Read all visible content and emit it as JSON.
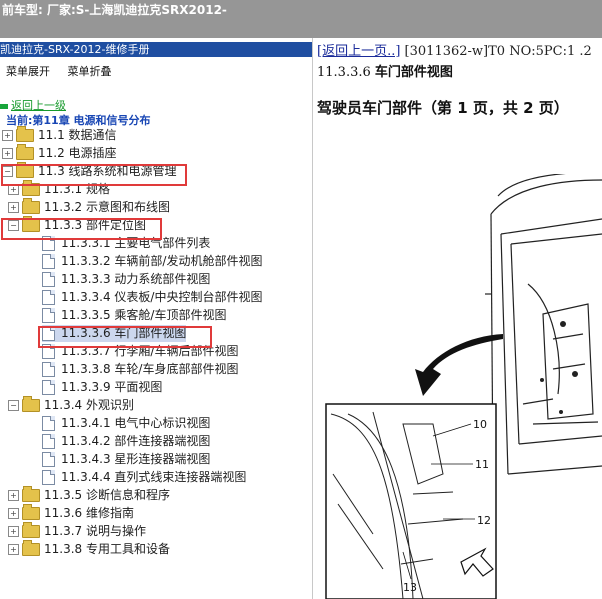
{
  "topbar": {
    "text": "前车型:   厂家:S-上海凯迪拉克SRX2012-"
  },
  "left_panel": {
    "title": "凯迪拉克-SRX-2012-维修手册",
    "expand_label": "菜单展开",
    "collapse_label": "菜单折叠",
    "back_up_label": "返回上一级",
    "current_label": "当前:第11章 电源和信号分布",
    "tree": [
      {
        "label": "11.1 数据通信",
        "type": "folder",
        "pm": "+"
      },
      {
        "label": "11.2 电源插座",
        "type": "folder",
        "pm": "+"
      },
      {
        "label": "11.3 线路系统和电源管理",
        "type": "folder",
        "pm": "-"
      },
      {
        "label": "11.3.1 规格",
        "type": "folder",
        "pm": "+"
      },
      {
        "label": "11.3.2 示意图和布线图",
        "type": "folder",
        "pm": "+"
      },
      {
        "label": "11.3.3 部件定位图",
        "type": "folder",
        "pm": "-"
      },
      {
        "label": "11.3.3.1 主要电气部件列表",
        "type": "doc"
      },
      {
        "label": "11.3.3.2 车辆前部/发动机舱部件视图",
        "type": "doc"
      },
      {
        "label": "11.3.3.3 动力系统部件视图",
        "type": "doc"
      },
      {
        "label": "11.3.3.4 仪表板/中央控制台部件视图",
        "type": "doc"
      },
      {
        "label": "11.3.3.5 乘客舱/车顶部件视图",
        "type": "doc"
      },
      {
        "label": "11.3.3.6 车门部件视图",
        "type": "doc"
      },
      {
        "label": "11.3.3.7 行李厢/车辆后部件视图",
        "type": "doc"
      },
      {
        "label": "11.3.3.8 车轮/车身底部部件视图",
        "type": "doc"
      },
      {
        "label": "11.3.3.9 平面视图",
        "type": "doc"
      },
      {
        "label": "11.3.4 外观识别",
        "type": "folder",
        "pm": "-"
      },
      {
        "label": "11.3.4.1 电气中心标识视图",
        "type": "doc"
      },
      {
        "label": "11.3.4.2 部件连接器端视图",
        "type": "doc"
      },
      {
        "label": "11.3.4.3 星形连接器端视图",
        "type": "doc"
      },
      {
        "label": "11.3.4.4 直列式线束连接器端视图",
        "type": "doc"
      },
      {
        "label": "11.3.5 诊断信息和程序",
        "type": "folder",
        "pm": "+"
      },
      {
        "label": "11.3.6 维修指南",
        "type": "folder",
        "pm": "+"
      },
      {
        "label": "11.3.7 说明与操作",
        "type": "folder",
        "pm": "+"
      },
      {
        "label": "11.3.8 专用工具和设备",
        "type": "folder",
        "pm": "+"
      }
    ]
  },
  "right_panel": {
    "back_link": "[返回上一页..]",
    "doc_code": " [3011362-w]T0 NO:5PC:1 .2",
    "section_number": "11.3.3.6",
    "section_title": "车门部件视图",
    "sub_title": "驾驶员车门部件（第 1 页，共 2 页）",
    "callouts": [
      "10",
      "11",
      "12",
      "13"
    ]
  },
  "colors": {
    "topbar": "#969696",
    "title_bar": "#1f4ea1",
    "highlight": "#e03a3a",
    "selected": "#ccd7ee",
    "back_up": "#169a2b"
  }
}
